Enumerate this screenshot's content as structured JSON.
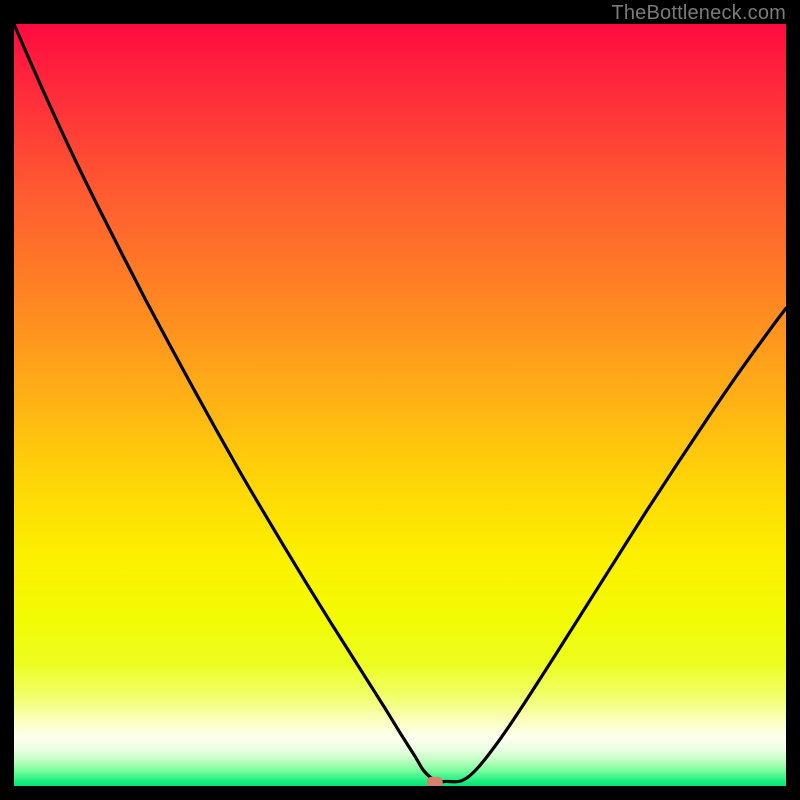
{
  "attribution": "TheBottleneck.com",
  "chart_data": {
    "type": "line",
    "title": "",
    "xlabel": "",
    "ylabel": "",
    "xlim": [
      0,
      100
    ],
    "ylim": [
      0,
      100
    ],
    "grid": false,
    "legend": false,
    "series": [
      {
        "name": "curve",
        "x": [
          0,
          2,
          5,
          8,
          11,
          14,
          17,
          20,
          23,
          26,
          29,
          32,
          35,
          38,
          41,
          44,
          46,
          48,
          50,
          51,
          52,
          53,
          54,
          55,
          56,
          58,
          60,
          63,
          66,
          70,
          74,
          78,
          82,
          86,
          90,
          94,
          98,
          100
        ],
        "y": [
          100,
          95.3,
          88.5,
          82,
          75.8,
          69.8,
          63.9,
          58.2,
          52.6,
          47.1,
          41.7,
          36.5,
          31.4,
          26.4,
          21.5,
          16.7,
          13.5,
          10.3,
          7,
          5.4,
          3.8,
          2.1,
          1.1,
          0.6,
          0.6,
          0.7,
          2.3,
          6.2,
          10.7,
          17,
          23.4,
          29.8,
          36.2,
          42.4,
          48.5,
          54.4,
          60,
          62.7
        ]
      }
    ],
    "marker": {
      "x": 54.5,
      "y": 0.5,
      "color": "#d5816d"
    },
    "gradient_stops": [
      {
        "offset": 0.0,
        "color": "#ff0b40"
      },
      {
        "offset": 0.1,
        "color": "#ff2f3a"
      },
      {
        "offset": 0.22,
        "color": "#ff5a30"
      },
      {
        "offset": 0.35,
        "color": "#ff8224"
      },
      {
        "offset": 0.48,
        "color": "#ffad17"
      },
      {
        "offset": 0.6,
        "color": "#ffd507"
      },
      {
        "offset": 0.7,
        "color": "#fcf000"
      },
      {
        "offset": 0.78,
        "color": "#f3fb03"
      },
      {
        "offset": 0.84,
        "color": "#ecfd21"
      },
      {
        "offset": 0.885,
        "color": "#f2ff71"
      },
      {
        "offset": 0.915,
        "color": "#f9ffbf"
      },
      {
        "offset": 0.935,
        "color": "#feffee"
      },
      {
        "offset": 0.95,
        "color": "#eeffe6"
      },
      {
        "offset": 0.965,
        "color": "#c5ffc4"
      },
      {
        "offset": 0.98,
        "color": "#79fc9d"
      },
      {
        "offset": 0.993,
        "color": "#20f07f"
      },
      {
        "offset": 1.0,
        "color": "#01e674"
      }
    ]
  }
}
